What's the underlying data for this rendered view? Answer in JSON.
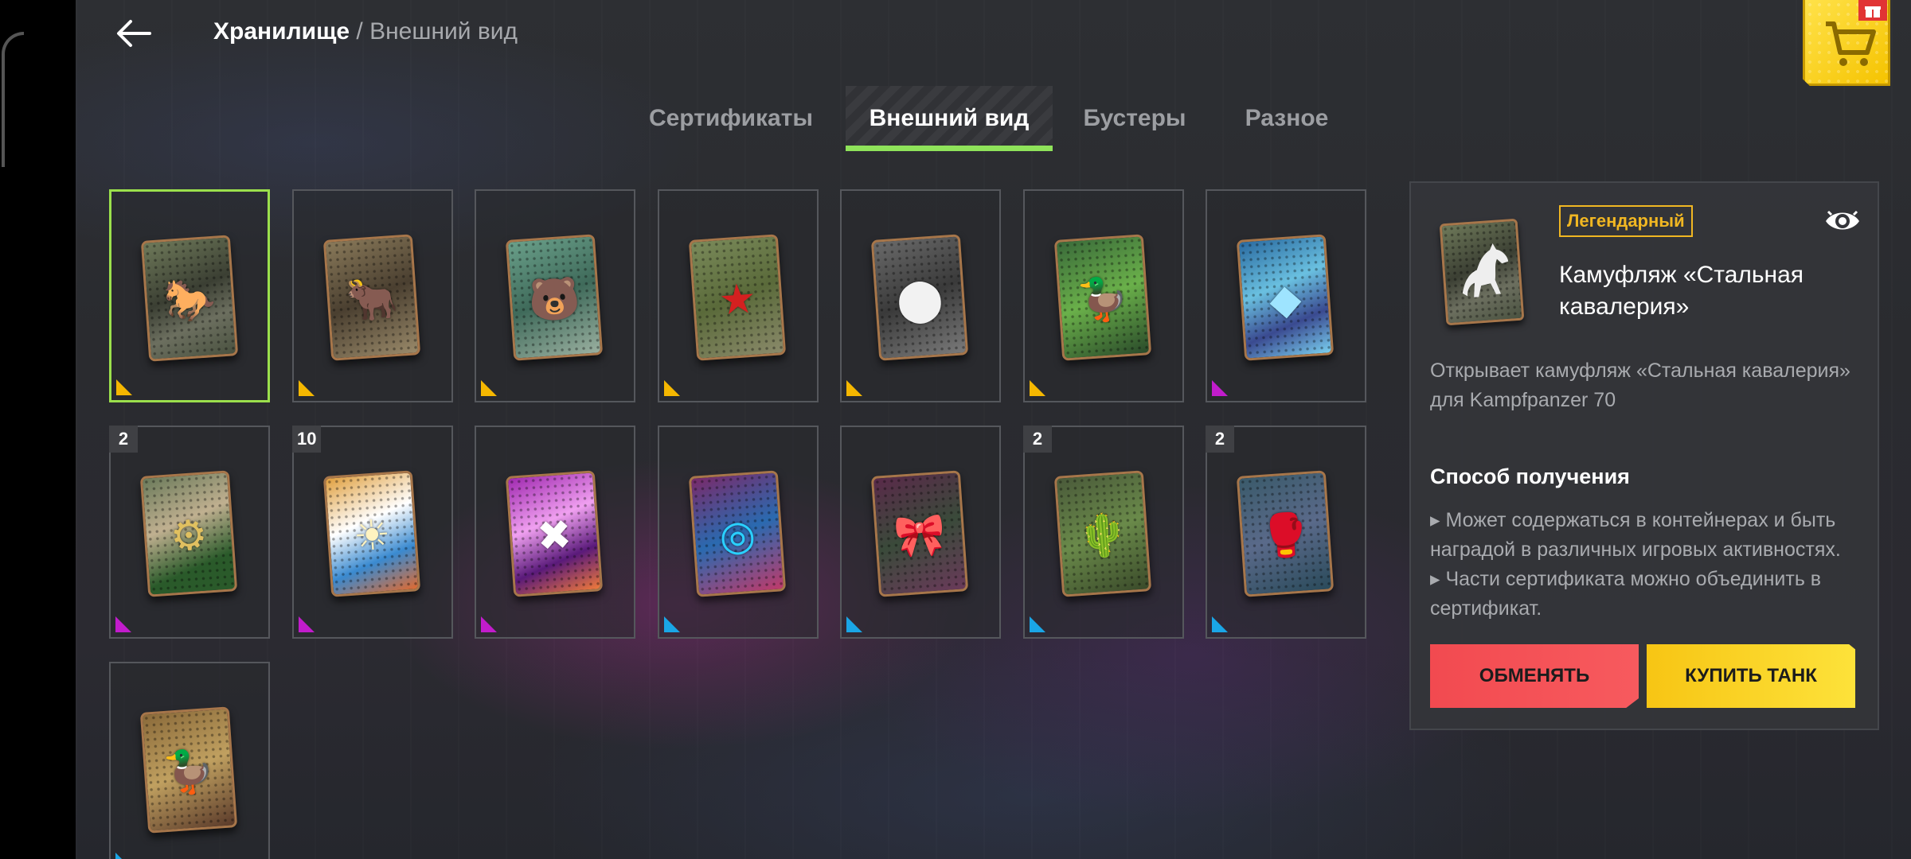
{
  "header": {
    "breadcrumb_root": "Хранилище",
    "breadcrumb_sep": " / ",
    "breadcrumb_current": "Внешний вид"
  },
  "tabs": [
    {
      "label": "Сертификаты",
      "active": false
    },
    {
      "label": "Внешний вид",
      "active": true
    },
    {
      "label": "Бустеры",
      "active": false
    },
    {
      "label": "Разное",
      "active": false
    }
  ],
  "colors": {
    "legendary": "#f5b700",
    "epic": "#c21ccc",
    "rare": "#1aa6e6",
    "selected_border": "#9be04c",
    "accent_green": "#8fe35a"
  },
  "items": [
    {
      "id": "steel-cavalry",
      "count": "",
      "rarity": "legendary",
      "icon": "horse-icon",
      "selected": true
    },
    {
      "id": "item-2",
      "count": "",
      "rarity": "legendary",
      "icon": "bull-icon"
    },
    {
      "id": "item-3",
      "count": "",
      "rarity": "legendary",
      "icon": "bear-face-icon"
    },
    {
      "id": "item-4",
      "count": "",
      "rarity": "legendary",
      "icon": "red-star-icon"
    },
    {
      "id": "item-5",
      "count": "",
      "rarity": "legendary",
      "icon": "circles-icon"
    },
    {
      "id": "item-6",
      "count": "",
      "rarity": "legendary",
      "icon": "duck-icon"
    },
    {
      "id": "item-7",
      "count": "",
      "rarity": "epic",
      "icon": "mosaic-icon"
    },
    {
      "id": "item-8",
      "count": "2",
      "rarity": "epic",
      "icon": "cannon-icon"
    },
    {
      "id": "item-9",
      "count": "10",
      "rarity": "epic",
      "icon": "sun-icon"
    },
    {
      "id": "item-10",
      "count": "",
      "rarity": "epic",
      "icon": "graffiti-icon"
    },
    {
      "id": "item-11",
      "count": "",
      "rarity": "rare",
      "icon": "target-icon"
    },
    {
      "id": "item-12",
      "count": "",
      "rarity": "rare",
      "icon": "bow-icon"
    },
    {
      "id": "item-13",
      "count": "2",
      "rarity": "rare",
      "icon": "cactus-icon"
    },
    {
      "id": "item-14",
      "count": "2",
      "rarity": "rare",
      "icon": "boxing-gloves-icon"
    },
    {
      "id": "item-15",
      "count": "",
      "rarity": "rare",
      "icon": "rubber-duck-icon"
    }
  ],
  "details": {
    "rarity_label": "Легендарный",
    "title": "Камуфляж «Стальная кавалерия»",
    "description": "Открывает камуфляж «Стальная кавалерия» для Kampfpanzer 70",
    "method_title": "Способ получения",
    "methods": [
      "▸ Может содержаться в контейнерах и быть наградой в различных игровых активностях.",
      "▸ Части сертификата можно объединить в сертификат."
    ],
    "exchange_label": "ОБМЕНЯТЬ",
    "buy_label": "КУПИТЬ ТАНК"
  }
}
